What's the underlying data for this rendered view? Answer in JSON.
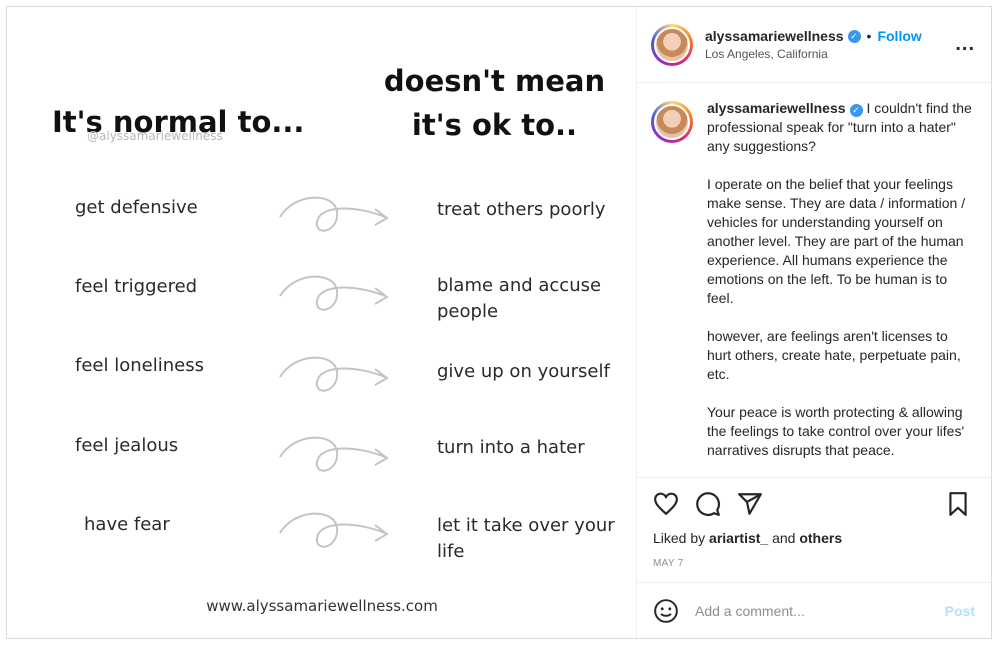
{
  "image": {
    "title_left": "It's normal to...",
    "watermark": "@alyssamariewellness",
    "title_right": "doesn't mean it's ok to..",
    "rows": [
      {
        "left": "get defensive",
        "right": "treat others poorly"
      },
      {
        "left": "feel triggered",
        "right": "blame and accuse people"
      },
      {
        "left": "feel loneliness",
        "right": "give up on yourself"
      },
      {
        "left": "feel jealous",
        "right": "turn into a hater"
      },
      {
        "left": "have fear",
        "right": "let it take over  your life"
      }
    ],
    "website": "www.alyssamariewellness.com"
  },
  "header": {
    "username": "alyssamariewellness",
    "verified_icon": "verified-badge-icon",
    "separator": "•",
    "follow_label": "Follow",
    "location": "Los Angeles, California",
    "more_label": "..."
  },
  "caption": {
    "username": "alyssamariewellness",
    "paragraphs": [
      "I couldn't find the professional speak for \"turn into a hater\" any suggestions?",
      "I operate on the belief that your feelings make sense. They are data / information / vehicles for understanding yourself on another level. They are part of the human experience. All humans experience the emotions on the left. To be human is to feel.",
      "however, are feelings aren't licenses to hurt others, create hate, perpetuate pain, etc.",
      "Your peace is worth protecting & allowing the feelings to take control over your lifes' narratives disrupts that peace."
    ]
  },
  "actions": {
    "icons": [
      "heart-icon",
      "comment-icon",
      "share-icon",
      "bookmark-icon"
    ]
  },
  "likes": {
    "prefix": "Liked by",
    "user": "ariartist_",
    "conjunction": "and",
    "others": "others"
  },
  "date": "MAY 7",
  "comment": {
    "placeholder": "Add a comment...",
    "post_label": "Post"
  },
  "colors": {
    "accent": "#0095f6",
    "verified": "#3897f0",
    "post_disabled": "#b2dffc"
  }
}
